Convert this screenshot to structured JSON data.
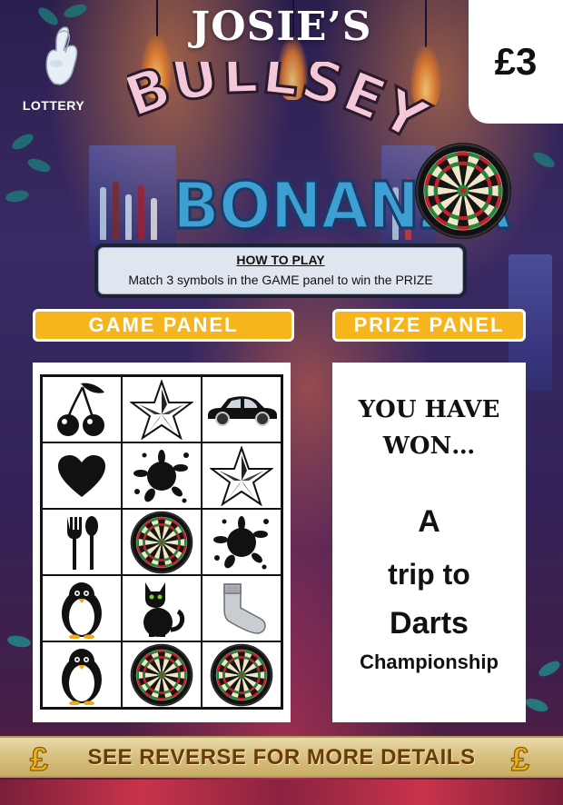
{
  "ticket": {
    "brand": "JOSIE’S",
    "lottery_label": "LOTTERY",
    "price": "£3",
    "title_line1": "BULLSEYE",
    "title_line2": "BONANZA"
  },
  "how_to_play": {
    "title": "HOW TO PLAY",
    "text": "Match 3 symbols in the GAME panel to win the PRIZE"
  },
  "panels": {
    "game_label": "GAME PANEL",
    "prize_label": "PRIZE PANEL"
  },
  "game_grid": [
    [
      "cherries-icon",
      "star-icon",
      "car-icon"
    ],
    [
      "heart-icon",
      "splat-icon",
      "star-icon"
    ],
    [
      "cutlery-icon",
      "dartboard-icon",
      "splat-icon"
    ],
    [
      "penguin-icon",
      "cat-icon",
      "sock-icon"
    ],
    [
      "penguin-icon",
      "dartboard-icon",
      "dartboard-icon"
    ]
  ],
  "prize": {
    "line1": "YOU HAVE",
    "line2": "WON…",
    "line3": "A",
    "line4": "trip to",
    "line5": "Darts",
    "line6": "Championship"
  },
  "footer": {
    "text": "SEE REVERSE FOR MORE DETAILS",
    "coin_symbol": "£"
  },
  "colors": {
    "panel_tab": "#f7b51d",
    "footer_gold": "#d6c080",
    "bonanza_blue": "#3ea0d2"
  }
}
